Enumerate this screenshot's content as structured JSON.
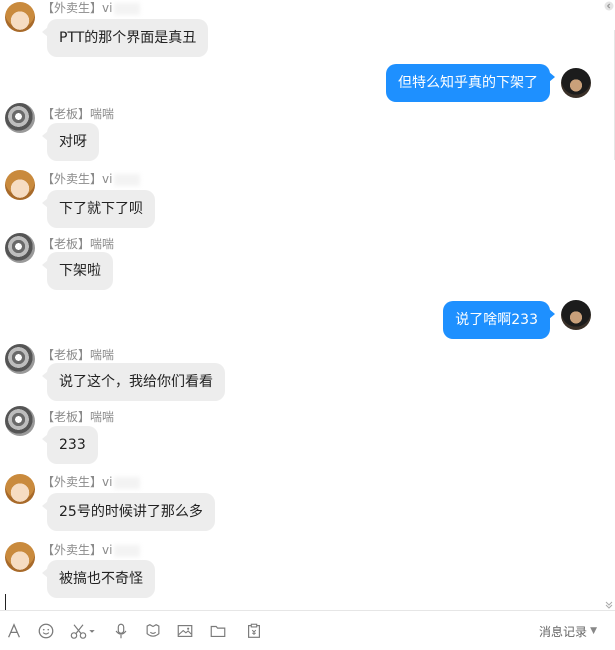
{
  "conversation": {
    "messages": [
      {
        "id": "m1",
        "side": "left",
        "avatar": "girl-avatar",
        "sender": "【外卖生】vi",
        "text": "PTT的那个界面是真丑"
      },
      {
        "id": "m2",
        "side": "right",
        "avatar": "me-avatar",
        "sender": "",
        "text": "但特么知乎真的下架了"
      },
      {
        "id": "m3",
        "side": "left",
        "avatar": "boss-avatar",
        "sender": "【老板】喘喘",
        "text": "对呀"
      },
      {
        "id": "m4",
        "side": "left",
        "avatar": "girl-avatar",
        "sender": "【外卖生】vi",
        "text": "下了就下了呗"
      },
      {
        "id": "m5",
        "side": "left",
        "avatar": "boss-avatar",
        "sender": "【老板】喘喘",
        "text": "下架啦"
      },
      {
        "id": "m6",
        "side": "right",
        "avatar": "me-avatar",
        "sender": "",
        "text": "说了啥啊233"
      },
      {
        "id": "m7",
        "side": "left",
        "avatar": "boss-avatar",
        "sender": "【老板】喘喘",
        "text": "说了这个，我给你们看看"
      },
      {
        "id": "m8",
        "side": "left",
        "avatar": "boss-avatar",
        "sender": "【老板】喘喘",
        "text": "233"
      },
      {
        "id": "m9",
        "side": "left",
        "avatar": "girl-avatar",
        "sender": "【外卖生】vi",
        "text": "25号的时候讲了那么多"
      },
      {
        "id": "m10",
        "side": "left",
        "avatar": "girl-avatar",
        "sender": "【外卖生】vi",
        "text": "被搞也不奇怪"
      }
    ]
  },
  "toolbar": {
    "icons": [
      "font-icon",
      "emoji-icon",
      "scissors-icon",
      "mic-icon",
      "sticker-icon",
      "image-icon",
      "folder-icon",
      "clipboard-icon"
    ],
    "history_label": "消息记录"
  },
  "colors": {
    "my_bubble": "#1e90ff",
    "other_bubble": "#ededed"
  }
}
